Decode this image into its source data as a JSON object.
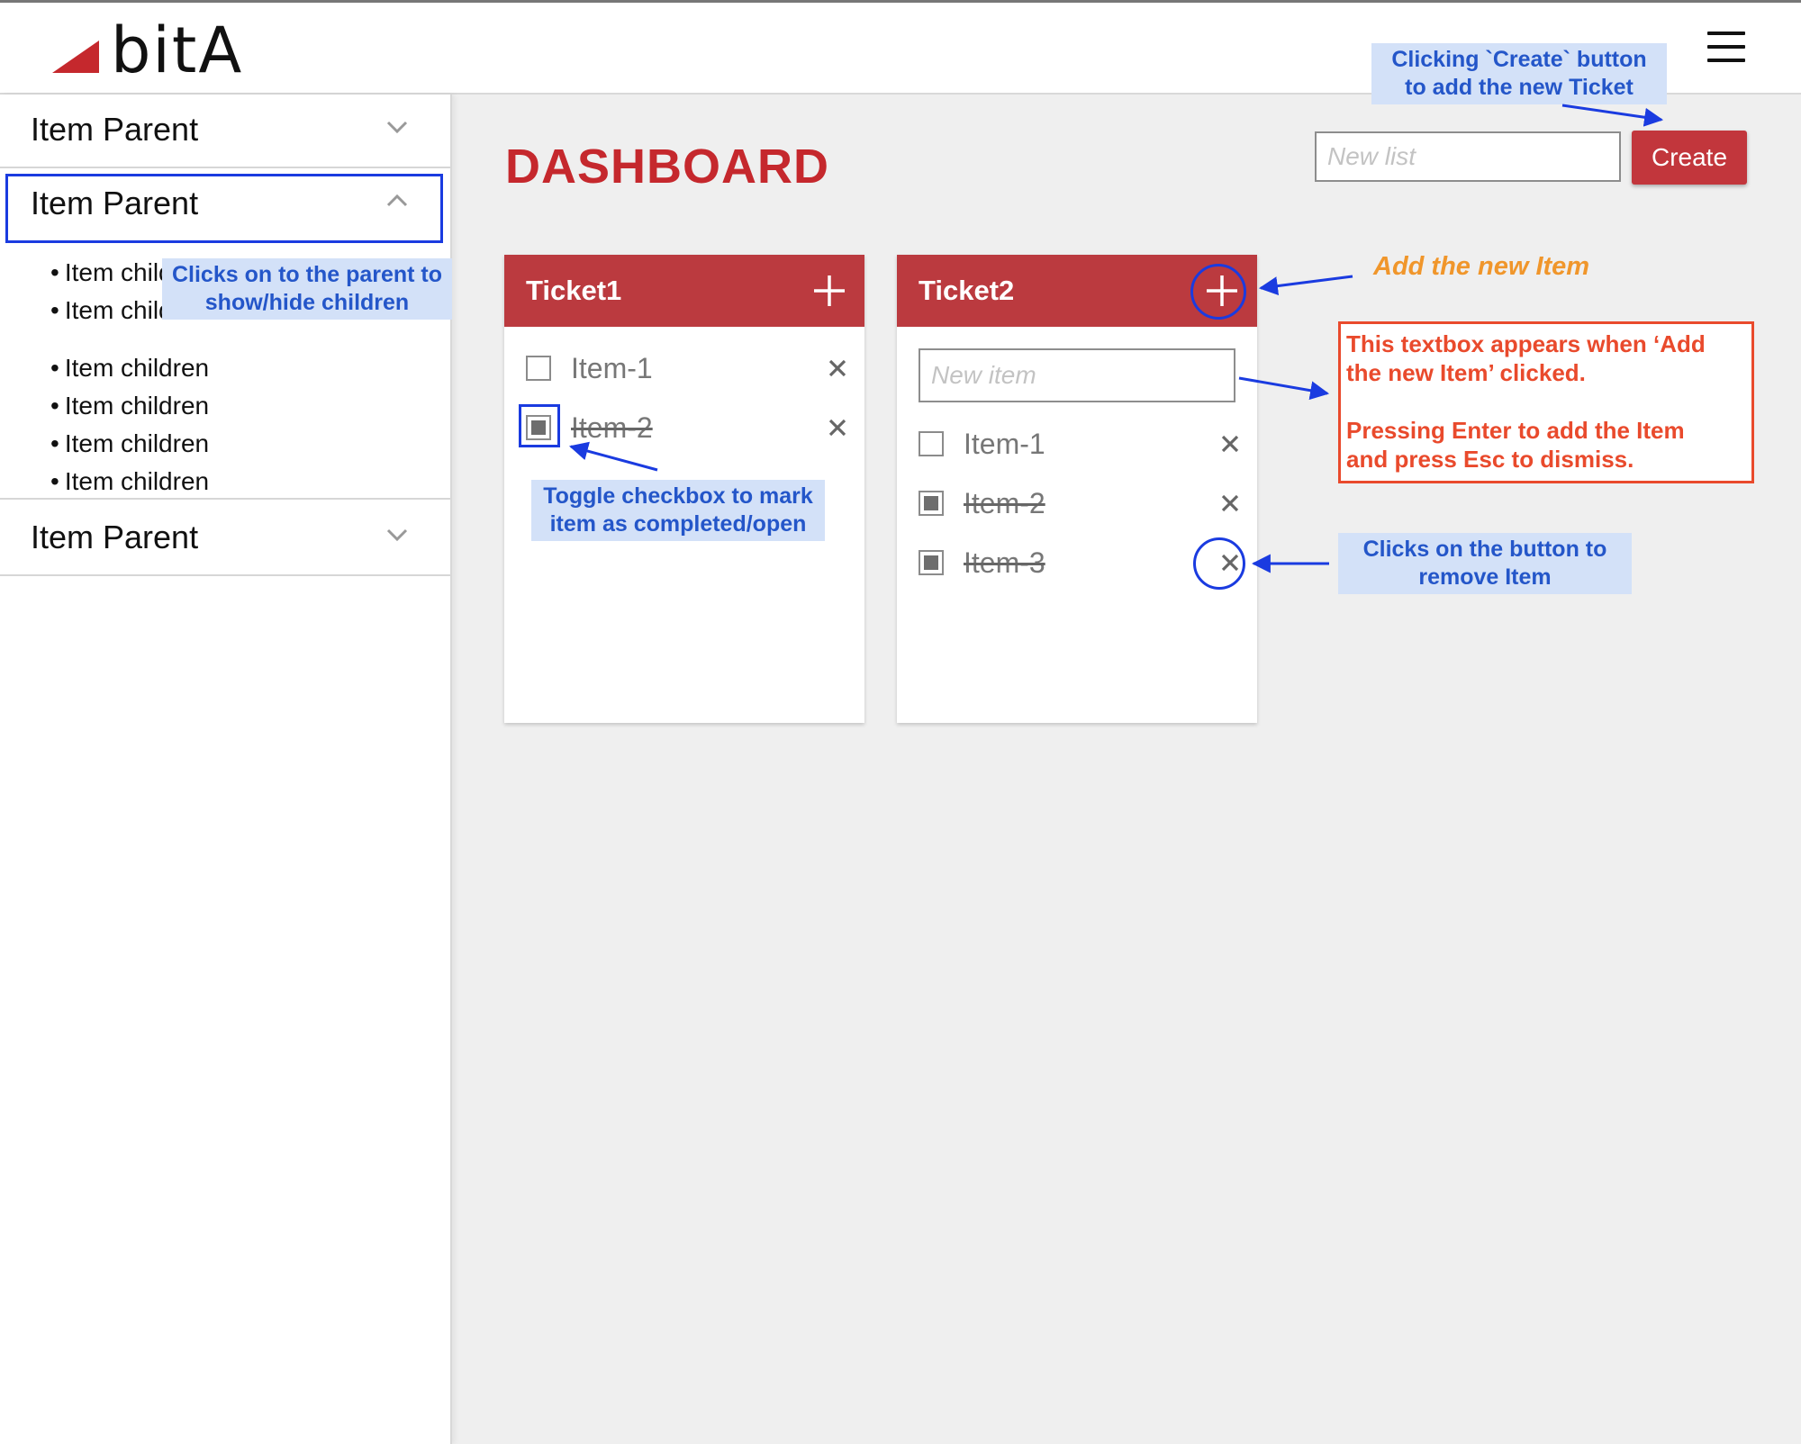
{
  "app": {
    "logo_text": "bitA",
    "brand_color": "#c5282d"
  },
  "header": {
    "menu_icon": "hamburger-icon"
  },
  "sidebar": {
    "parents": [
      {
        "label": "Item Parent",
        "expanded": false,
        "chevron": "chevron-down-icon"
      },
      {
        "label": "Item Parent",
        "expanded": true,
        "chevron": "chevron-up-icon",
        "children": [
          "Item children",
          "Item children",
          "Item children",
          "Item children",
          "Item children",
          "Item children"
        ]
      },
      {
        "label": "Item Parent",
        "expanded": false,
        "chevron": "chevron-down-icon"
      }
    ]
  },
  "main": {
    "title": "DASHBOARD",
    "new_list": {
      "value": "",
      "placeholder": "New list"
    },
    "create_label": "Create",
    "tickets": [
      {
        "title": "Ticket1",
        "items": [
          {
            "label": "Item-1",
            "done": false
          },
          {
            "label": "Item-2",
            "done": true
          }
        ]
      },
      {
        "title": "Ticket2",
        "new_item": {
          "value": "",
          "placeholder": "New item"
        },
        "items": [
          {
            "label": "Item-1",
            "done": false
          },
          {
            "label": "Item-2",
            "done": true
          },
          {
            "label": "Item-3",
            "done": true
          }
        ]
      }
    ]
  },
  "annotations": {
    "create_hint": [
      "Clicking `Create` button",
      "to add the new Ticket"
    ],
    "parent_hint": [
      "Clicks on to the parent to",
      "show/hide children"
    ],
    "toggle_hint": [
      "Toggle checkbox to mark",
      "item as completed/open"
    ],
    "add_item_hint": "Add the new Item",
    "textbox_hint": [
      "This textbox appears when ‘Add",
      "the new Item’ clicked.",
      "Pressing Enter to add the Item",
      "and press Esc to dismiss."
    ],
    "remove_hint": [
      "Clicks on the button to",
      "remove Item"
    ],
    "colors": {
      "blue": "#2456c9",
      "orange": "#f0962b",
      "red": "#e94a2c"
    }
  }
}
